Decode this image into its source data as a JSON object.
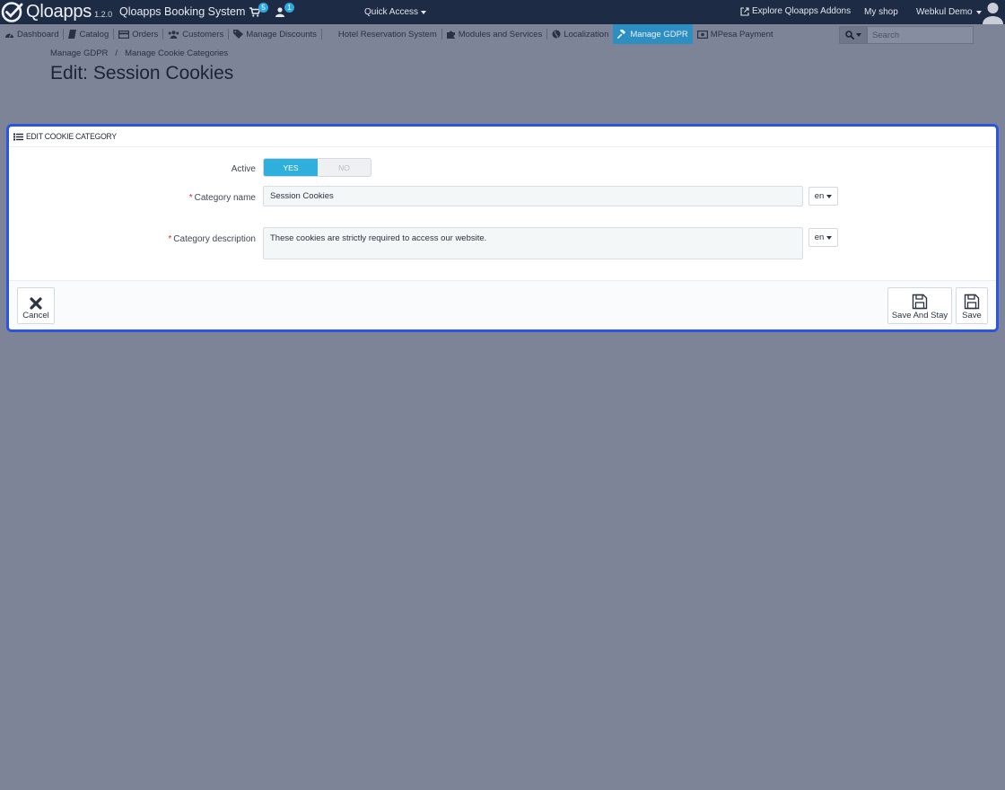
{
  "header": {
    "logo_text": "Qloapps",
    "version": "1.2.0",
    "shop_name": "Qloapps Booking System",
    "cart_count": "5",
    "customer_count": "1",
    "quick_access": "Quick Access",
    "explore": "Explore Qloapps Addons",
    "my_shop": "My shop",
    "employee": "Webkul Demo"
  },
  "menu": {
    "items": [
      {
        "label": "Dashboard",
        "icon": "dashboard-icon"
      },
      {
        "label": "Catalog",
        "icon": "book-icon"
      },
      {
        "label": "Orders",
        "icon": "credit-card-icon"
      },
      {
        "label": "Customers",
        "icon": "users-icon"
      },
      {
        "label": "Manage Discounts",
        "icon": "tags-icon"
      },
      {
        "label": "Hotel Reservation System",
        "icon": "hotel-icon"
      },
      {
        "label": "Modules and Services",
        "icon": "puzzle-icon"
      },
      {
        "label": "Localization",
        "icon": "globe-icon"
      },
      {
        "label": "Manage GDPR",
        "icon": "gavel-icon",
        "active": true
      },
      {
        "label": "MPesa Payment",
        "icon": "money-icon"
      }
    ],
    "active_color": "#2d8ec2"
  },
  "search": {
    "placeholder": "Search"
  },
  "breadcrumb": {
    "level1": "Manage GDPR",
    "separator": "/",
    "level2": "Manage Cookie Categories"
  },
  "page_title": "Edit: Session Cookies",
  "panel": {
    "title": "EDIT COOKIE CATEGORY",
    "active_label": "Active",
    "yes_label": "YES",
    "no_label": "NO",
    "active_value": "yes",
    "name_label": "Category name",
    "name_value": "Session Cookies",
    "description_label": "Category description",
    "description_value": "These cookies are strictly required to access our website.",
    "required_mark": "*",
    "lang": "en",
    "cancel_label": "Cancel",
    "save_stay_label": "Save And Stay",
    "save_label": "Save"
  },
  "colors": {
    "topbar": "#1d2b45",
    "switch_on": "#2fb0dc",
    "panel_border": "#2a55e0",
    "required": "#e0262f"
  }
}
